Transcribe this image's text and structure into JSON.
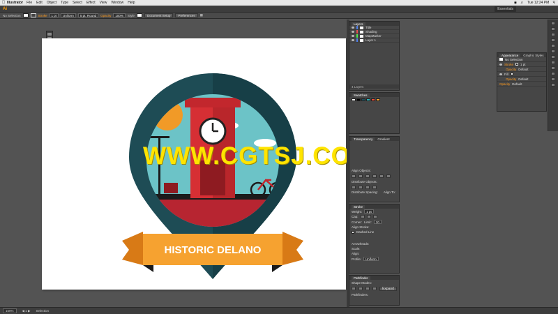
{
  "menubar": {
    "app": "Illustrator",
    "items": [
      "File",
      "Edit",
      "Object",
      "Type",
      "Select",
      "Effect",
      "View",
      "Window",
      "Help"
    ],
    "clock": "Tue 12:24 PM"
  },
  "appbar": {
    "logo": "Ai",
    "workspace": "Essentials"
  },
  "control": {
    "selection": "No Selection",
    "stroke_label": "Stroke",
    "stroke_weight": "1 pt",
    "profile": "Uniform",
    "brush": "5 pt. Round",
    "opacity_label": "Opacity",
    "opacity": "100%",
    "style_label": "Style",
    "doc_setup": "Document Setup",
    "preferences": "Preferences"
  },
  "artwork": {
    "banner_text": "HISTORIC DELANO"
  },
  "watermark": "WWW.CGTSJ.COM",
  "status": {
    "zoom": "150%",
    "tool": "Selection"
  },
  "layers": {
    "tab": "Layers",
    "items": [
      {
        "name": "Title",
        "color": "#4f7ee8"
      },
      {
        "name": "Shading",
        "color": "#e84f4f"
      },
      {
        "name": "MapMarker",
        "color": "#4fe84f"
      },
      {
        "name": "Layer 1",
        "color": "#4f7ee8"
      }
    ],
    "footer": "4 Layers"
  },
  "swatches": {
    "tab": "Swatches",
    "colors": [
      "#ffffff",
      "#000000",
      "#1d4e5a",
      "#2ab0b5",
      "#e94a3a",
      "#f6a230"
    ]
  },
  "transparency": {
    "tabs": [
      "Transparency",
      "Gradient"
    ]
  },
  "align": {
    "title": "Align Objects:",
    "distribute_objects": "Distribute Objects:",
    "distribute_spacing": "Distribute Spacing:",
    "align_to": "Align To:"
  },
  "stroke_panel": {
    "title": "Stroke",
    "weight_label": "Weight:",
    "weight": "1 pt",
    "cap_label": "Cap:",
    "corner_label": "Corner:",
    "limit_label": "Limit:",
    "limit": "10",
    "align_label": "Align Stroke:",
    "dashed": "Dashed Line",
    "arrowheads": "Arrowheads:",
    "scale": "Scale:",
    "align2": "Align:",
    "profile_label": "Profile:",
    "profile": "Uniform"
  },
  "pathfinder": {
    "title": "Pathfinder",
    "shape_modes": "Shape Modes:",
    "pathfinders": "Pathfinders:",
    "expand": "Expand"
  },
  "appearance": {
    "tabs": [
      "Appearance",
      "Graphic Styles"
    ],
    "selection": "No Selection",
    "stroke_label": "Stroke",
    "stroke_value": "1 pt",
    "opacity_label": "Opacity",
    "opacity_value": "Default",
    "fill_label": "Fill"
  }
}
